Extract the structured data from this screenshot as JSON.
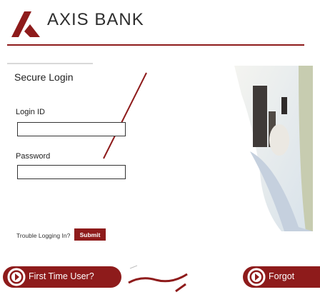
{
  "brand": {
    "name": "AXIS BANK",
    "accent_color": "#8e1b1b",
    "logo_icon": "axis-triangle-logo"
  },
  "login": {
    "title": "Secure Login",
    "login_id_label": "Login ID",
    "login_id_value": "",
    "password_label": "Password",
    "password_value": "",
    "trouble_text": "Trouble Logging In?",
    "submit_label": "Submit"
  },
  "actions": {
    "first_time_label": "First Time User?",
    "forgot_label": "Forgot",
    "arrow_icon": "circle-arrow-icon"
  }
}
